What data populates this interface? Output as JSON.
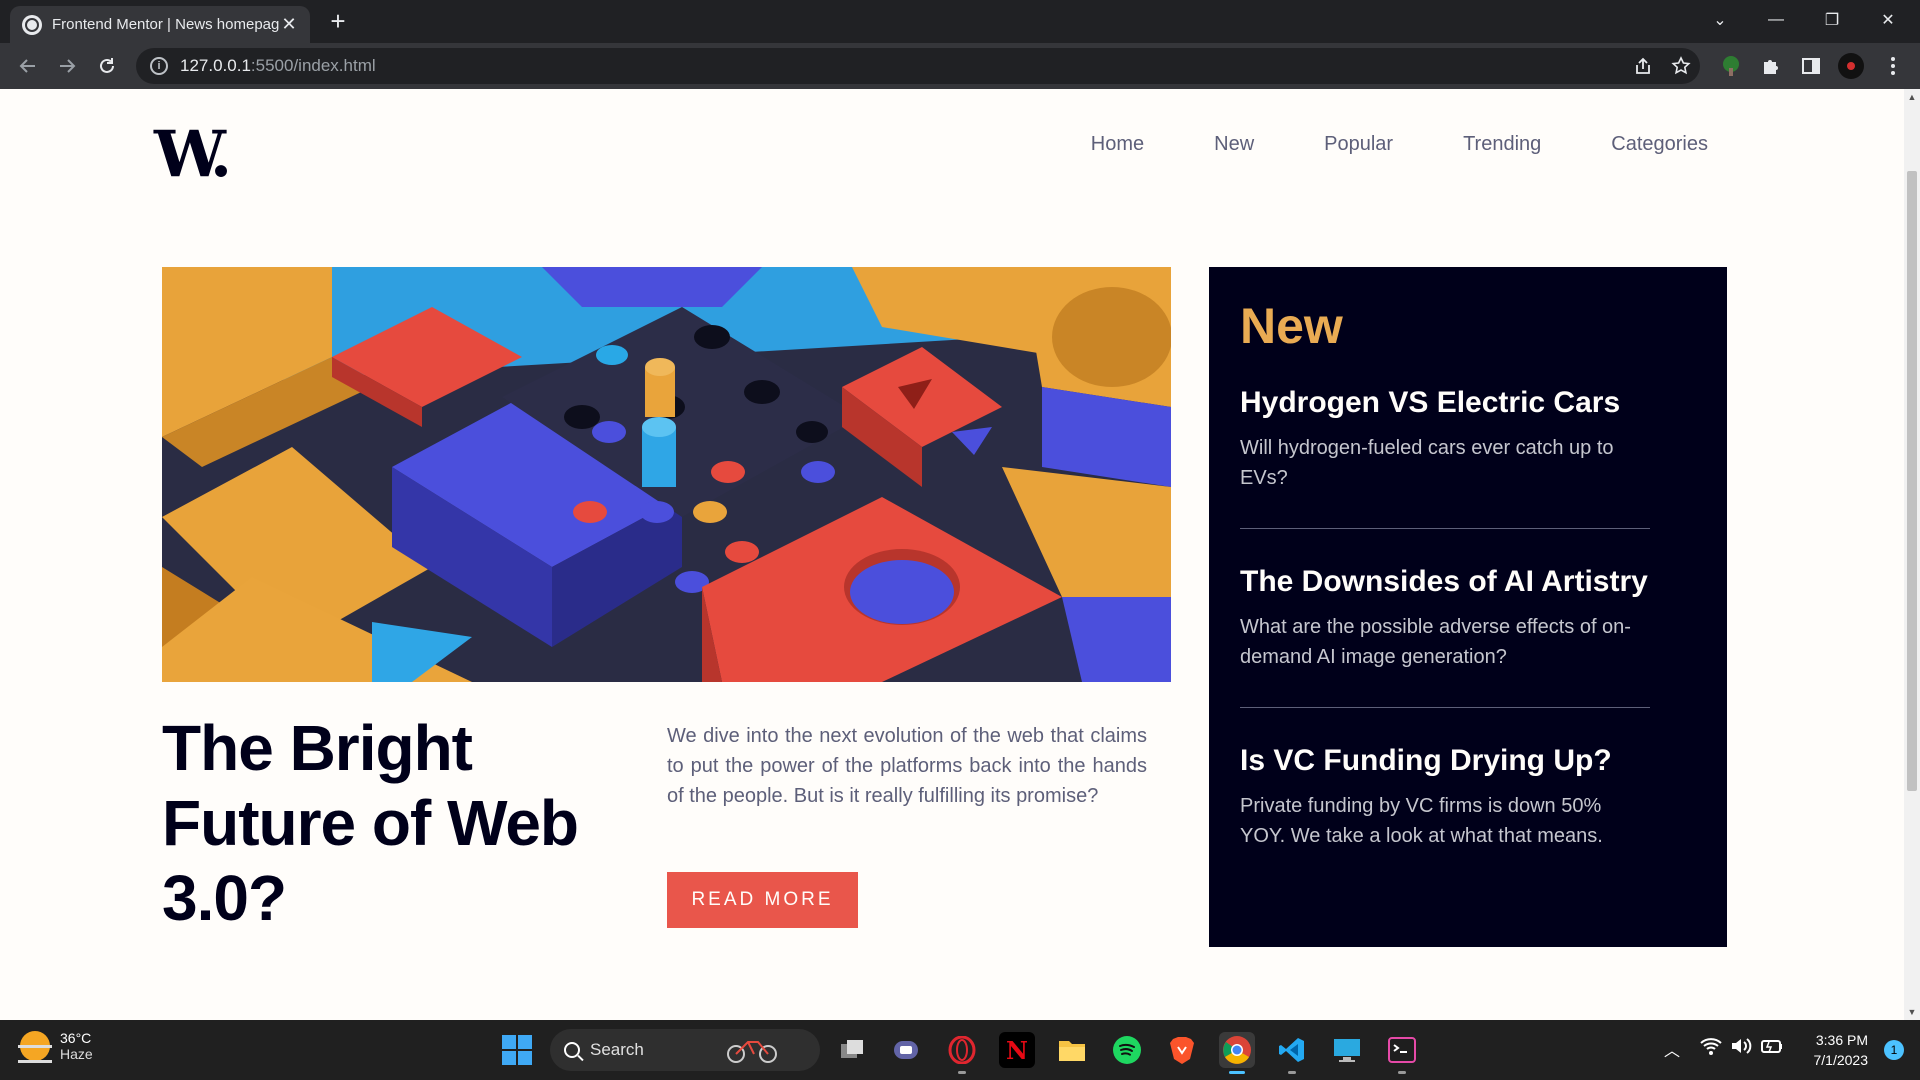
{
  "browser": {
    "tab_title": "Frontend Mentor | News homepage",
    "tab_close": "✕",
    "new_tab": "+",
    "url_host": "127.0.0.1",
    "url_path": ":5500/index.html",
    "window_controls": [
      "⌄",
      "—",
      "❐",
      "✕"
    ]
  },
  "page": {
    "logo": "W.",
    "nav": [
      "Home",
      "New",
      "Popular",
      "Trending",
      "Categories"
    ],
    "hero": {
      "title": "The Bright Future of Web 3.0?",
      "description": "We dive into the next evolution of the web that claims to put the power of the platforms back into the hands of the people. But is it really fulfilling its promise?",
      "button": "READ MORE"
    },
    "new_section": {
      "title": "New",
      "items": [
        {
          "title": "Hydrogen VS Electric Cars",
          "text": "Will hydrogen-fueled cars ever catch up to EVs?"
        },
        {
          "title": "The Downsides of AI Artistry",
          "text": "What are the possible adverse effects of on-demand AI image generation?"
        },
        {
          "title": "Is VC Funding Drying Up?",
          "text": "Private funding by VC firms is down 50% YOY. We take a look at what that means."
        }
      ]
    }
  },
  "taskbar": {
    "weather_temp": "36°C",
    "weather_desc": "Haze",
    "search_label": "Search",
    "time": "3:36 PM",
    "date": "7/1/2023",
    "notification_count": "1"
  },
  "colors": {
    "accent_red": "#e9564b",
    "accent_orange": "#e9ab53",
    "dark_navy": "#00001a",
    "off_white": "#fffdfa",
    "grayish_blue": "#5d5f79"
  }
}
